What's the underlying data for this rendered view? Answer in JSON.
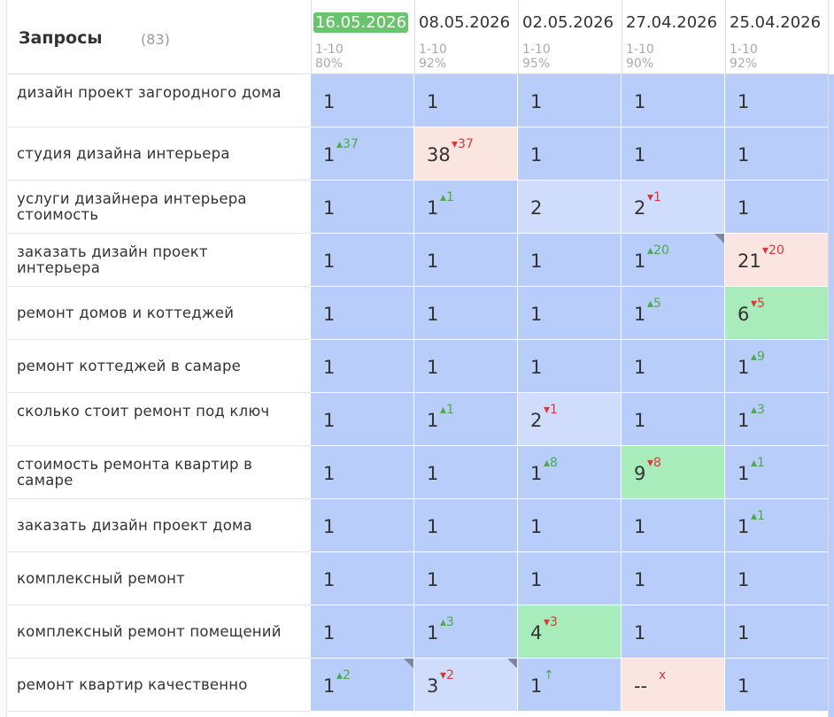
{
  "header": {
    "title": "Запросы",
    "count": "(83)"
  },
  "colors": {
    "same": "#b9cdfa",
    "worse": "#cfdcfc",
    "better": "#a8ecbc",
    "dropped": "#fbe5e1",
    "current_date_bg": "#6ac46e"
  },
  "dates": [
    {
      "date": "16.05.2026",
      "range": "1-10",
      "pct": "80%",
      "current": true
    },
    {
      "date": "08.05.2026",
      "range": "1-10",
      "pct": "92%",
      "current": false
    },
    {
      "date": "02.05.2026",
      "range": "1-10",
      "pct": "95%",
      "current": false
    },
    {
      "date": "27.04.2026",
      "range": "1-10",
      "pct": "90%",
      "current": false
    },
    {
      "date": "25.04.2026",
      "range": "1-10",
      "pct": "92%",
      "current": false
    }
  ],
  "rows": [
    {
      "query": "дизайн проект загородного дома",
      "cells": [
        {
          "v": "1",
          "d": "",
          "dir": "",
          "bg": "same"
        },
        {
          "v": "1",
          "d": "",
          "dir": "",
          "bg": "same"
        },
        {
          "v": "1",
          "d": "",
          "dir": "",
          "bg": "same"
        },
        {
          "v": "1",
          "d": "",
          "dir": "",
          "bg": "same"
        },
        {
          "v": "1",
          "d": "",
          "dir": "",
          "bg": "same"
        }
      ]
    },
    {
      "query": "студия дизайна интерьера",
      "cells": [
        {
          "v": "1",
          "d": "37",
          "dir": "up",
          "bg": "same"
        },
        {
          "v": "38",
          "d": "37",
          "dir": "down",
          "bg": "dropped"
        },
        {
          "v": "1",
          "d": "",
          "dir": "",
          "bg": "same"
        },
        {
          "v": "1",
          "d": "",
          "dir": "",
          "bg": "same"
        },
        {
          "v": "1",
          "d": "",
          "dir": "",
          "bg": "same"
        }
      ]
    },
    {
      "query": "услуги дизайнера интерьера стоимость",
      "cells": [
        {
          "v": "1",
          "d": "",
          "dir": "",
          "bg": "same"
        },
        {
          "v": "1",
          "d": "1",
          "dir": "up",
          "bg": "same"
        },
        {
          "v": "2",
          "d": "",
          "dir": "",
          "bg": "worse"
        },
        {
          "v": "2",
          "d": "1",
          "dir": "down",
          "bg": "worse"
        },
        {
          "v": "1",
          "d": "",
          "dir": "",
          "bg": "same"
        }
      ]
    },
    {
      "query": "заказать дизайн проект интерьера",
      "cells": [
        {
          "v": "1",
          "d": "",
          "dir": "",
          "bg": "same"
        },
        {
          "v": "1",
          "d": "",
          "dir": "",
          "bg": "same"
        },
        {
          "v": "1",
          "d": "",
          "dir": "",
          "bg": "same"
        },
        {
          "v": "1",
          "d": "20",
          "dir": "up",
          "bg": "same",
          "corner": true
        },
        {
          "v": "21",
          "d": "20",
          "dir": "down",
          "bg": "dropped"
        }
      ]
    },
    {
      "query": "ремонт домов и коттеджей",
      "cells": [
        {
          "v": "1",
          "d": "",
          "dir": "",
          "bg": "same"
        },
        {
          "v": "1",
          "d": "",
          "dir": "",
          "bg": "same"
        },
        {
          "v": "1",
          "d": "",
          "dir": "",
          "bg": "same"
        },
        {
          "v": "1",
          "d": "5",
          "dir": "up",
          "bg": "same"
        },
        {
          "v": "6",
          "d": "5",
          "dir": "down",
          "bg": "better"
        }
      ]
    },
    {
      "query": "ремонт коттеджей в самаре",
      "cells": [
        {
          "v": "1",
          "d": "",
          "dir": "",
          "bg": "same"
        },
        {
          "v": "1",
          "d": "",
          "dir": "",
          "bg": "same"
        },
        {
          "v": "1",
          "d": "",
          "dir": "",
          "bg": "same"
        },
        {
          "v": "1",
          "d": "",
          "dir": "",
          "bg": "same"
        },
        {
          "v": "1",
          "d": "9",
          "dir": "up",
          "bg": "same"
        }
      ]
    },
    {
      "query": "сколько стоит ремонт под ключ",
      "cells": [
        {
          "v": "1",
          "d": "",
          "dir": "",
          "bg": "same"
        },
        {
          "v": "1",
          "d": "1",
          "dir": "up",
          "bg": "same"
        },
        {
          "v": "2",
          "d": "1",
          "dir": "down",
          "bg": "worse"
        },
        {
          "v": "1",
          "d": "",
          "dir": "",
          "bg": "same"
        },
        {
          "v": "1",
          "d": "3",
          "dir": "up",
          "bg": "same"
        }
      ]
    },
    {
      "query": "стоимость ремонта квартир в самаре",
      "cells": [
        {
          "v": "1",
          "d": "",
          "dir": "",
          "bg": "same"
        },
        {
          "v": "1",
          "d": "",
          "dir": "",
          "bg": "same"
        },
        {
          "v": "1",
          "d": "8",
          "dir": "up",
          "bg": "same"
        },
        {
          "v": "9",
          "d": "8",
          "dir": "down",
          "bg": "better"
        },
        {
          "v": "1",
          "d": "1",
          "dir": "up",
          "bg": "same"
        }
      ]
    },
    {
      "query": "заказать дизайн проект дома",
      "cells": [
        {
          "v": "1",
          "d": "",
          "dir": "",
          "bg": "same"
        },
        {
          "v": "1",
          "d": "",
          "dir": "",
          "bg": "same"
        },
        {
          "v": "1",
          "d": "",
          "dir": "",
          "bg": "same"
        },
        {
          "v": "1",
          "d": "",
          "dir": "",
          "bg": "same"
        },
        {
          "v": "1",
          "d": "1",
          "dir": "up",
          "bg": "same"
        }
      ]
    },
    {
      "query": "комплексный ремонт",
      "cells": [
        {
          "v": "1",
          "d": "",
          "dir": "",
          "bg": "same"
        },
        {
          "v": "1",
          "d": "",
          "dir": "",
          "bg": "same"
        },
        {
          "v": "1",
          "d": "",
          "dir": "",
          "bg": "same"
        },
        {
          "v": "1",
          "d": "",
          "dir": "",
          "bg": "same"
        },
        {
          "v": "1",
          "d": "",
          "dir": "",
          "bg": "same"
        }
      ]
    },
    {
      "query": "комплексный ремонт помещений",
      "cells": [
        {
          "v": "1",
          "d": "",
          "dir": "",
          "bg": "same"
        },
        {
          "v": "1",
          "d": "3",
          "dir": "up",
          "bg": "same"
        },
        {
          "v": "4",
          "d": "3",
          "dir": "down",
          "bg": "better"
        },
        {
          "v": "1",
          "d": "",
          "dir": "",
          "bg": "same"
        },
        {
          "v": "1",
          "d": "",
          "dir": "",
          "bg": "same"
        }
      ]
    },
    {
      "query": "ремонт квартир качественно",
      "cells": [
        {
          "v": "1",
          "d": "2",
          "dir": "up",
          "bg": "same",
          "corner": true
        },
        {
          "v": "3",
          "d": "2",
          "dir": "down",
          "bg": "worse",
          "corner": true
        },
        {
          "v": "1",
          "d": "↑",
          "dir": "up",
          "bg": "same"
        },
        {
          "v": "--",
          "d": "x",
          "dir": "down",
          "bg": "dropped"
        },
        {
          "v": "1",
          "d": "",
          "dir": "",
          "bg": "same"
        }
      ]
    }
  ]
}
